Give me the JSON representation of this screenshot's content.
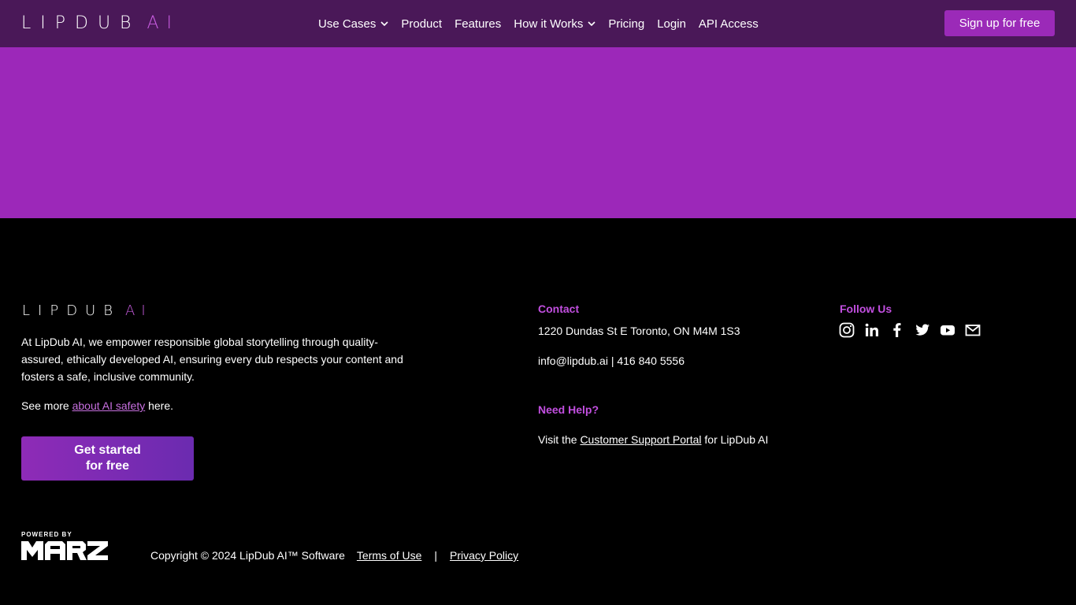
{
  "header": {
    "logo_letters": "LIPDUB",
    "logo_ai": "AI",
    "nav": [
      {
        "label": "Use Cases",
        "dropdown": true
      },
      {
        "label": "Product",
        "dropdown": false
      },
      {
        "label": "Features",
        "dropdown": false
      },
      {
        "label": "How it Works",
        "dropdown": true
      },
      {
        "label": "Pricing",
        "dropdown": false
      },
      {
        "label": "Login",
        "dropdown": false
      },
      {
        "label": "API Access",
        "dropdown": false
      }
    ],
    "signup_label": "Sign up for free"
  },
  "footer": {
    "about_text": "At LipDub AI, we empower responsible global storytelling through quality-assured, ethically developed AI, ensuring every dub respects your content and fosters a safe, inclusive community.",
    "see_more_prefix": "See more ",
    "see_more_link": "about AI safety",
    "see_more_suffix": " here.",
    "cta_label": "Get started for free",
    "contact_heading": "Contact",
    "address": "1220 Dundas St E Toronto, ON M4M 1S3",
    "email_phone": "info@lipdub.ai | 416 840 5556",
    "help_heading": "Need Help?",
    "support_prefix": "Visit the ",
    "support_link": "Customer Support Portal",
    "support_suffix": " for LipDub AI",
    "follow_heading": "Follow Us",
    "socials": [
      "instagram-icon",
      "linkedin-icon",
      "facebook-icon",
      "twitter-icon",
      "youtube-icon",
      "mail-icon"
    ],
    "powered_by": "POWERED BY",
    "powered_brand": "MARZ",
    "copyright": "Copyright © 2024 LipDub AI™ Software",
    "terms": "Terms of Use",
    "separator": "|",
    "privacy": "Privacy Policy"
  },
  "colors": {
    "header_bg": "#4a1858",
    "banner_bg": "#9c28b9",
    "accent": "#9b2ab8",
    "heading": "#c24fe0"
  }
}
